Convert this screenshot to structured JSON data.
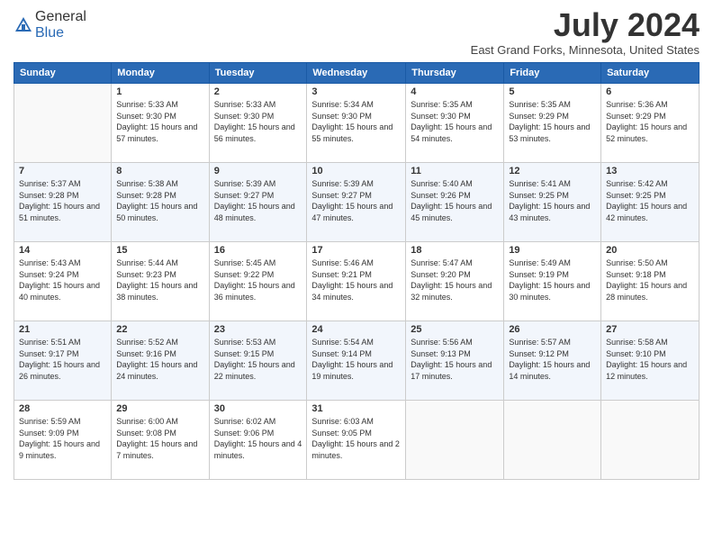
{
  "header": {
    "logo_general": "General",
    "logo_blue": "Blue",
    "month_title": "July 2024",
    "location": "East Grand Forks, Minnesota, United States"
  },
  "days_of_week": [
    "Sunday",
    "Monday",
    "Tuesday",
    "Wednesday",
    "Thursday",
    "Friday",
    "Saturday"
  ],
  "weeks": [
    [
      {
        "day": "",
        "sunrise": "",
        "sunset": "",
        "daylight": ""
      },
      {
        "day": "1",
        "sunrise": "Sunrise: 5:33 AM",
        "sunset": "Sunset: 9:30 PM",
        "daylight": "Daylight: 15 hours and 57 minutes."
      },
      {
        "day": "2",
        "sunrise": "Sunrise: 5:33 AM",
        "sunset": "Sunset: 9:30 PM",
        "daylight": "Daylight: 15 hours and 56 minutes."
      },
      {
        "day": "3",
        "sunrise": "Sunrise: 5:34 AM",
        "sunset": "Sunset: 9:30 PM",
        "daylight": "Daylight: 15 hours and 55 minutes."
      },
      {
        "day": "4",
        "sunrise": "Sunrise: 5:35 AM",
        "sunset": "Sunset: 9:30 PM",
        "daylight": "Daylight: 15 hours and 54 minutes."
      },
      {
        "day": "5",
        "sunrise": "Sunrise: 5:35 AM",
        "sunset": "Sunset: 9:29 PM",
        "daylight": "Daylight: 15 hours and 53 minutes."
      },
      {
        "day": "6",
        "sunrise": "Sunrise: 5:36 AM",
        "sunset": "Sunset: 9:29 PM",
        "daylight": "Daylight: 15 hours and 52 minutes."
      }
    ],
    [
      {
        "day": "7",
        "sunrise": "Sunrise: 5:37 AM",
        "sunset": "Sunset: 9:28 PM",
        "daylight": "Daylight: 15 hours and 51 minutes."
      },
      {
        "day": "8",
        "sunrise": "Sunrise: 5:38 AM",
        "sunset": "Sunset: 9:28 PM",
        "daylight": "Daylight: 15 hours and 50 minutes."
      },
      {
        "day": "9",
        "sunrise": "Sunrise: 5:39 AM",
        "sunset": "Sunset: 9:27 PM",
        "daylight": "Daylight: 15 hours and 48 minutes."
      },
      {
        "day": "10",
        "sunrise": "Sunrise: 5:39 AM",
        "sunset": "Sunset: 9:27 PM",
        "daylight": "Daylight: 15 hours and 47 minutes."
      },
      {
        "day": "11",
        "sunrise": "Sunrise: 5:40 AM",
        "sunset": "Sunset: 9:26 PM",
        "daylight": "Daylight: 15 hours and 45 minutes."
      },
      {
        "day": "12",
        "sunrise": "Sunrise: 5:41 AM",
        "sunset": "Sunset: 9:25 PM",
        "daylight": "Daylight: 15 hours and 43 minutes."
      },
      {
        "day": "13",
        "sunrise": "Sunrise: 5:42 AM",
        "sunset": "Sunset: 9:25 PM",
        "daylight": "Daylight: 15 hours and 42 minutes."
      }
    ],
    [
      {
        "day": "14",
        "sunrise": "Sunrise: 5:43 AM",
        "sunset": "Sunset: 9:24 PM",
        "daylight": "Daylight: 15 hours and 40 minutes."
      },
      {
        "day": "15",
        "sunrise": "Sunrise: 5:44 AM",
        "sunset": "Sunset: 9:23 PM",
        "daylight": "Daylight: 15 hours and 38 minutes."
      },
      {
        "day": "16",
        "sunrise": "Sunrise: 5:45 AM",
        "sunset": "Sunset: 9:22 PM",
        "daylight": "Daylight: 15 hours and 36 minutes."
      },
      {
        "day": "17",
        "sunrise": "Sunrise: 5:46 AM",
        "sunset": "Sunset: 9:21 PM",
        "daylight": "Daylight: 15 hours and 34 minutes."
      },
      {
        "day": "18",
        "sunrise": "Sunrise: 5:47 AM",
        "sunset": "Sunset: 9:20 PM",
        "daylight": "Daylight: 15 hours and 32 minutes."
      },
      {
        "day": "19",
        "sunrise": "Sunrise: 5:49 AM",
        "sunset": "Sunset: 9:19 PM",
        "daylight": "Daylight: 15 hours and 30 minutes."
      },
      {
        "day": "20",
        "sunrise": "Sunrise: 5:50 AM",
        "sunset": "Sunset: 9:18 PM",
        "daylight": "Daylight: 15 hours and 28 minutes."
      }
    ],
    [
      {
        "day": "21",
        "sunrise": "Sunrise: 5:51 AM",
        "sunset": "Sunset: 9:17 PM",
        "daylight": "Daylight: 15 hours and 26 minutes."
      },
      {
        "day": "22",
        "sunrise": "Sunrise: 5:52 AM",
        "sunset": "Sunset: 9:16 PM",
        "daylight": "Daylight: 15 hours and 24 minutes."
      },
      {
        "day": "23",
        "sunrise": "Sunrise: 5:53 AM",
        "sunset": "Sunset: 9:15 PM",
        "daylight": "Daylight: 15 hours and 22 minutes."
      },
      {
        "day": "24",
        "sunrise": "Sunrise: 5:54 AM",
        "sunset": "Sunset: 9:14 PM",
        "daylight": "Daylight: 15 hours and 19 minutes."
      },
      {
        "day": "25",
        "sunrise": "Sunrise: 5:56 AM",
        "sunset": "Sunset: 9:13 PM",
        "daylight": "Daylight: 15 hours and 17 minutes."
      },
      {
        "day": "26",
        "sunrise": "Sunrise: 5:57 AM",
        "sunset": "Sunset: 9:12 PM",
        "daylight": "Daylight: 15 hours and 14 minutes."
      },
      {
        "day": "27",
        "sunrise": "Sunrise: 5:58 AM",
        "sunset": "Sunset: 9:10 PM",
        "daylight": "Daylight: 15 hours and 12 minutes."
      }
    ],
    [
      {
        "day": "28",
        "sunrise": "Sunrise: 5:59 AM",
        "sunset": "Sunset: 9:09 PM",
        "daylight": "Daylight: 15 hours and 9 minutes."
      },
      {
        "day": "29",
        "sunrise": "Sunrise: 6:00 AM",
        "sunset": "Sunset: 9:08 PM",
        "daylight": "Daylight: 15 hours and 7 minutes."
      },
      {
        "day": "30",
        "sunrise": "Sunrise: 6:02 AM",
        "sunset": "Sunset: 9:06 PM",
        "daylight": "Daylight: 15 hours and 4 minutes."
      },
      {
        "day": "31",
        "sunrise": "Sunrise: 6:03 AM",
        "sunset": "Sunset: 9:05 PM",
        "daylight": "Daylight: 15 hours and 2 minutes."
      },
      {
        "day": "",
        "sunrise": "",
        "sunset": "",
        "daylight": ""
      },
      {
        "day": "",
        "sunrise": "",
        "sunset": "",
        "daylight": ""
      },
      {
        "day": "",
        "sunrise": "",
        "sunset": "",
        "daylight": ""
      }
    ]
  ]
}
